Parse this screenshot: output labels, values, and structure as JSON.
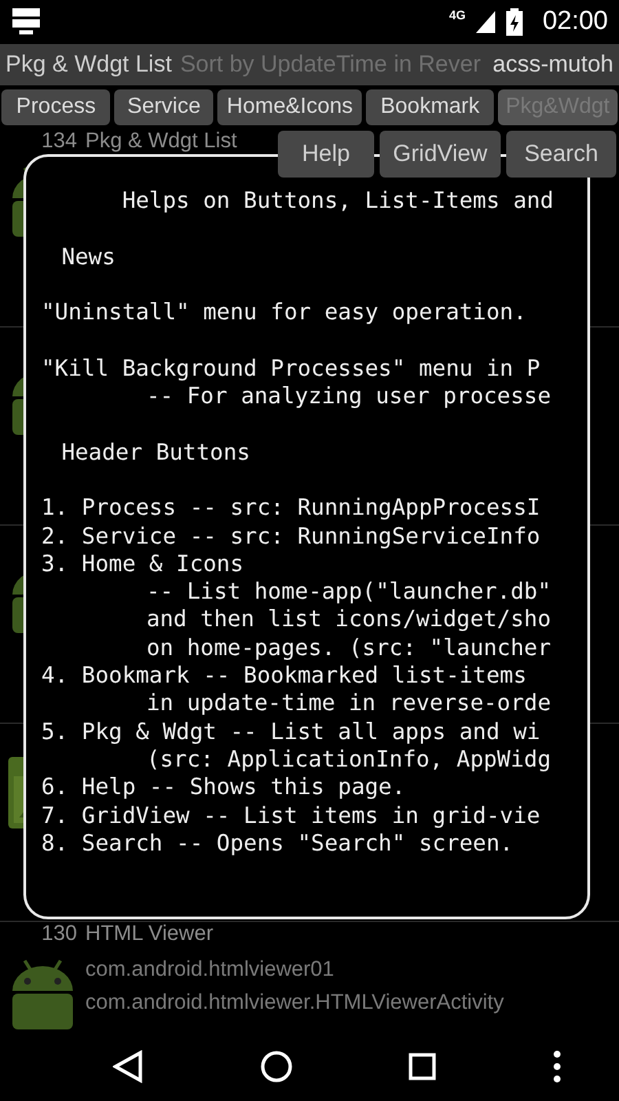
{
  "status_bar": {
    "network": "4G",
    "time": "02:00"
  },
  "title_bar": {
    "title": "Pkg & Wdgt List",
    "subtitle": "Sort by UpdateTime in Rever",
    "account": "acss-mutoh"
  },
  "tabs": [
    {
      "label": "Process",
      "selected": false
    },
    {
      "label": "Service",
      "selected": false
    },
    {
      "label": "Home&Icons",
      "selected": false
    },
    {
      "label": "Bookmark",
      "selected": false
    },
    {
      "label": "Pkg&Wdgt",
      "selected": true
    }
  ],
  "action_buttons": [
    "Help",
    "GridView",
    "Search"
  ],
  "list": [
    {
      "kind": "android",
      "number": "134",
      "name": "Pkg & Wdgt List"
    },
    {
      "kind": "android"
    },
    {
      "kind": "android"
    },
    {
      "kind": "image"
    },
    {
      "kind": "android",
      "number": "130",
      "name": "HTML Viewer",
      "lines": [
        "com.android.htmlviewer01",
        "com.android.htmlviewer.HTMLViewerActivity"
      ]
    }
  ],
  "help_dialog": {
    "title": "Helps on Buttons, List-Items and",
    "sections": [
      {
        "heading": "News",
        "kind": "spaced",
        "items": [
          {
            "lines": [
              "\"Uninstall\" menu for easy operation."
            ]
          },
          {
            "lines": [
              "\"Kill Background Processes\" menu in P",
              "-- For analyzing user processe"
            ]
          }
        ]
      },
      {
        "heading": "Header Buttons",
        "kind": "compact",
        "items": [
          {
            "lines": [
              "1. Process -- src: RunningAppProcessI"
            ]
          },
          {
            "lines": [
              "2. Service -- src: RunningServiceInfo"
            ]
          },
          {
            "lines": [
              "3. Home & Icons",
              "-- List home-app(\"launcher.db\"",
              "and then list icons/widget/sho",
              "on home-pages. (src: \"launcher"
            ]
          },
          {
            "lines": [
              "4. Bookmark -- Bookmarked list-items",
              "in update-time in reverse-orde"
            ]
          },
          {
            "lines": [
              "5. Pkg & Wdgt -- List all apps and wi",
              "(src: ApplicationInfo, AppWidg"
            ]
          },
          {
            "lines": [
              "6. Help -- Shows this page."
            ]
          },
          {
            "lines": [
              "7. GridView -- List items in grid-vie"
            ]
          },
          {
            "lines": [
              "8. Search -- Opens \"Search\" screen."
            ]
          }
        ]
      }
    ]
  }
}
